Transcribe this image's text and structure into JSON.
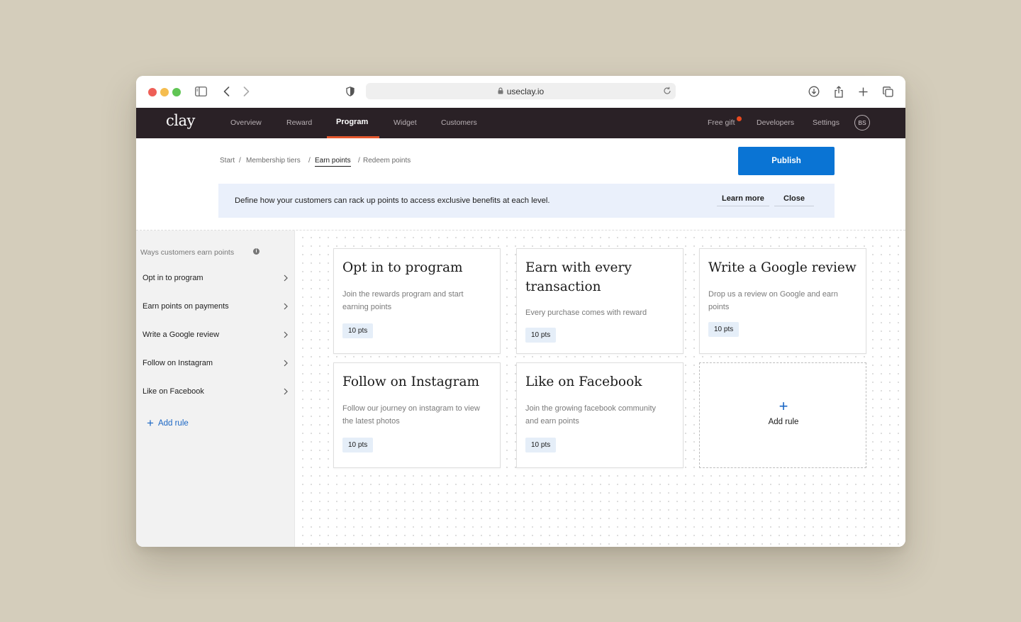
{
  "browser": {
    "url": "useclay.io"
  },
  "app": {
    "logo": "clay",
    "nav": [
      {
        "label": "Overview"
      },
      {
        "label": "Reward"
      },
      {
        "label": "Program"
      },
      {
        "label": "Widget"
      },
      {
        "label": "Customers"
      }
    ],
    "nav_active": "Program",
    "right_nav": [
      {
        "label": "Free gift"
      },
      {
        "label": "Developers"
      },
      {
        "label": "Settings"
      }
    ],
    "avatar_initials": "BS"
  },
  "breadcrumb": {
    "items": [
      "Start",
      "Membership tiers",
      "Earn points",
      "Redeem points"
    ],
    "separator": "/",
    "current": "Earn points"
  },
  "publish_label": "Publish",
  "banner": {
    "text": "Define how your customers can rack up points to access exclusive  benefits at each level.",
    "learn_more": "Learn more",
    "close": "Close"
  },
  "sidebar": {
    "title": "Ways customers earn points",
    "info_glyph": "i",
    "items": [
      {
        "label": "Opt in to program"
      },
      {
        "label": "Earn points on payments"
      },
      {
        "label": "Write a Google review"
      },
      {
        "label": "Follow on Instagram"
      },
      {
        "label": "Like on Facebook"
      }
    ],
    "add_rule": "Add rule",
    "add_glyph": "+"
  },
  "cards": [
    {
      "title": "Opt in to program",
      "description": "Join the rewards program and start earning points",
      "points": "10 pts"
    },
    {
      "title": "Earn with every transaction",
      "description": "Every purchase comes with reward",
      "points": "10 pts"
    },
    {
      "title": "Write a Google review",
      "description": "Drop us a review on Google and earn points",
      "points": "10 pts"
    },
    {
      "title": "Follow on Instagram",
      "description": "Follow our journey on instagram to view the latest photos",
      "points": "10 pts"
    },
    {
      "title": "Like on Facebook",
      "description": "Join the growing facebook community and earn points",
      "points": "10 pts"
    }
  ],
  "add_card": {
    "glyph": "+",
    "label": "Add rule"
  },
  "colors": {
    "nav_bg": "#2a2126",
    "accent_blue": "#0a74d4",
    "active_underline": "#e4572e",
    "notification": "#e9491f",
    "banner_bg": "#eaf0fb",
    "points_badge_bg": "#e5eef8"
  }
}
